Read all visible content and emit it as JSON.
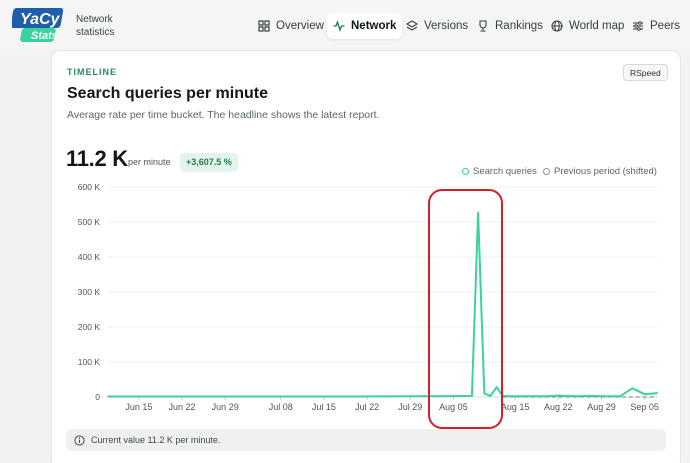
{
  "app": {
    "brand_sub_line1": "Network",
    "brand_sub_line2": "statistics"
  },
  "nav": [
    {
      "label": "Overview",
      "icon": "grid-icon",
      "active": false
    },
    {
      "label": "Network",
      "icon": "activity-icon",
      "active": true
    },
    {
      "label": "Versions",
      "icon": "layers-icon",
      "active": false
    },
    {
      "label": "Rankings",
      "icon": "trophy-icon",
      "active": false
    },
    {
      "label": "World map",
      "icon": "globe-icon",
      "active": false
    },
    {
      "label": "Peers",
      "icon": "sliders-icon",
      "active": false
    }
  ],
  "panel": {
    "eyebrow": "TIMELINE",
    "tag": "RSpeed",
    "title": "Search queries per minute",
    "subtitle": "Average rate per time bucket. The headline shows the latest report.",
    "value": "11.2 K",
    "unit": "per minute",
    "delta": "+3,607.5 %",
    "footer": "Current value 11.2 K per minute."
  },
  "legend": {
    "current": "Search queries",
    "previous": "Previous period (shifted)"
  },
  "colors": {
    "accent": "#38d39f",
    "highlight": "#d21f2a",
    "previous": "#8c9590"
  },
  "chart_data": {
    "type": "line",
    "title": "",
    "xlabel": "",
    "ylabel": "",
    "ylim": [
      0,
      600000
    ],
    "y_ticks": [
      "0",
      "100 K",
      "200 K",
      "300 K",
      "400 K",
      "500 K",
      "600 K"
    ],
    "x_ticks": [
      "Jun 15",
      "Jun 22",
      "Jun 29",
      "Jul 08",
      "Jul 15",
      "Jul 22",
      "Jul 29",
      "Aug 05",
      "Aug 15",
      "Aug 22",
      "Aug 29",
      "Sep 05"
    ],
    "grid": true,
    "legend": "top-right",
    "series": [
      {
        "name": "Search queries",
        "x": [
          "Jun 10",
          "Jun 20",
          "Jul 01",
          "Jul 10",
          "Jul 20",
          "Jul 30",
          "Aug 05",
          "Aug 08",
          "Aug 09",
          "Aug 10",
          "Aug 11",
          "Aug 12",
          "Aug 13",
          "Aug 14",
          "Aug 16",
          "Aug 20",
          "Aug 22",
          "Aug 25",
          "Aug 27",
          "Aug 29",
          "Sep 01",
          "Sep 03",
          "Sep 05",
          "Sep 07"
        ],
        "values": [
          1500,
          1500,
          1500,
          1500,
          1500,
          2000,
          2500,
          3000,
          527000,
          10000,
          3000,
          28000,
          3000,
          2000,
          2000,
          2000,
          4000,
          2000,
          3000,
          2000,
          2000,
          25000,
          8000,
          11200
        ]
      },
      {
        "name": "Previous period (shifted)",
        "x": [
          "Aug 13",
          "Sep 07"
        ],
        "values": [
          0,
          0
        ]
      }
    ]
  }
}
